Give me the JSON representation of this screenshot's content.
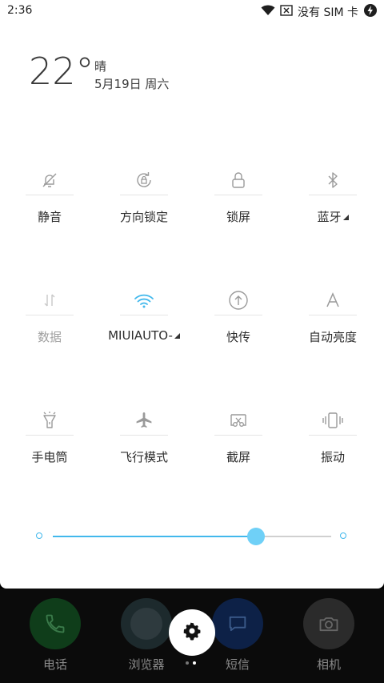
{
  "status": {
    "time": "2:36",
    "sim_text": "没有 SIM 卡"
  },
  "weather": {
    "temperature": "22°",
    "condition": "晴",
    "date": "5月19日 周六"
  },
  "tiles": [
    {
      "label": "静音",
      "icon": "bell-off-icon",
      "enabled": true
    },
    {
      "label": "方向锁定",
      "icon": "rotation-lock-icon",
      "enabled": true
    },
    {
      "label": "锁屏",
      "icon": "lock-icon",
      "enabled": true
    },
    {
      "label": "蓝牙",
      "icon": "bluetooth-icon",
      "enabled": true,
      "has_menu": true
    },
    {
      "label": "数据",
      "icon": "mobile-data-icon",
      "enabled": false
    },
    {
      "label": "MIUIAUTO-",
      "icon": "wifi-icon",
      "enabled": true,
      "has_menu": true,
      "active": true
    },
    {
      "label": "快传",
      "icon": "quick-transfer-icon",
      "enabled": true
    },
    {
      "label": "自动亮度",
      "icon": "auto-brightness-icon",
      "enabled": true
    },
    {
      "label": "手电筒",
      "icon": "flashlight-icon",
      "enabled": true
    },
    {
      "label": "飞行模式",
      "icon": "airplane-icon",
      "enabled": true
    },
    {
      "label": "截屏",
      "icon": "screenshot-icon",
      "enabled": true
    },
    {
      "label": "振动",
      "icon": "vibrate-icon",
      "enabled": true
    }
  ],
  "brightness": {
    "level": 0.73
  },
  "dock": [
    {
      "label": "电话",
      "icon": "phone-icon",
      "color": "#0f3d1a"
    },
    {
      "label": "浏览器",
      "icon": "browser-icon",
      "color": "#1d2a2d"
    },
    {
      "label": "短信",
      "icon": "message-icon",
      "color": "#0d2147"
    },
    {
      "label": "相机",
      "icon": "camera-icon",
      "color": "#2b2b2b"
    }
  ],
  "colors": {
    "accent": "#42b8ec",
    "thumb": "#6fd0f7",
    "icon": "#9a9a9a"
  },
  "page_dots": {
    "count": 2,
    "active": 1
  }
}
